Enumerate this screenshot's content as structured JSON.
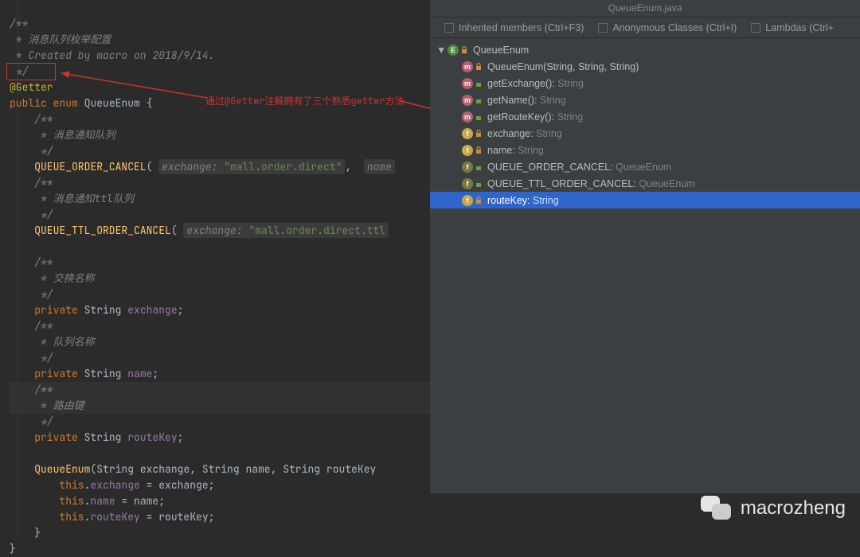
{
  "tab_title": "QueueEnum.java",
  "filters": {
    "inherited": "Inherited members (Ctrl+F3)",
    "anon": "Anonymous Classes (Ctrl+I)",
    "lambdas": "Lambdas (Ctrl+"
  },
  "annotation_note": "通过@Getter注解拥有了三个熟悉getter方法",
  "code": {
    "l1": "/**",
    "l2": " * 消息队列枚举配置",
    "l3": " * Created by macro on 2018/9/14.",
    "l4": " */",
    "l5_annot": "@Getter",
    "l6_a": "public",
    "l6_b": "enum",
    "l6_c": "QueueEnum",
    "l6_d": "{",
    "l7": "    /**",
    "l8": "     * 消息通知队列",
    "l9": "     */",
    "l10_name": "QUEUE_ORDER_CANCEL",
    "l10_hint": "exchange:",
    "l10_str": "\"mall.order.direct\"",
    "l10_hint2": "name",
    "l11": "    /**",
    "l12": "     * 消息通知ttl队列",
    "l13": "     */",
    "l14_name": "QUEUE_TTL_ORDER_CANCEL",
    "l14_hint": "exchange:",
    "l14_str": "\"mall.order.direct.ttl",
    "l16": "    /**",
    "l17": "     * 交换名称",
    "l18": "     */",
    "l19_a": "private",
    "l19_b": "String",
    "l19_c": "exchange",
    "l19_d": ";",
    "l20": "    /**",
    "l21": "     * 队列名称",
    "l22": "     */",
    "l23_a": "private",
    "l23_b": "String",
    "l23_c": "name",
    "l23_d": ";",
    "l24": "    /**",
    "l25": "     * 路由键",
    "l26": "     */",
    "l27_a": "private",
    "l27_b": "String",
    "l27_c": "routeKey",
    "l27_d": ";",
    "l29_a": "QueueEnum",
    "l29_b": "String",
    "l29_c": "exchange",
    "l29_d": "String",
    "l29_e": "name",
    "l29_f": "String",
    "l29_g": "routeKey",
    "l30_a": "this",
    "l30_b": "exchange",
    "l30_c": "exchange",
    "l31_a": "this",
    "l31_b": "name",
    "l31_c": "name",
    "l32_a": "this",
    "l32_b": "routeKey",
    "l32_c": "routeKey",
    "l33": "    }",
    "l34": "}"
  },
  "tree": {
    "root": "QueueEnum",
    "n1": "QueueEnum(String, String, String)",
    "n2": "getExchange(): ",
    "n2r": "String",
    "n3": "getName(): ",
    "n3r": "String",
    "n4": "getRouteKey(): ",
    "n4r": "String",
    "n5": "exchange: ",
    "n5r": "String",
    "n6": "name: ",
    "n6r": "String",
    "n7": "QUEUE_ORDER_CANCEL: ",
    "n7r": "QueueEnum",
    "n8": "QUEUE_TTL_ORDER_CANCEL: ",
    "n8r": "QueueEnum",
    "n9": "routeKey: ",
    "n9r": "String"
  },
  "watermark": "macrozheng"
}
